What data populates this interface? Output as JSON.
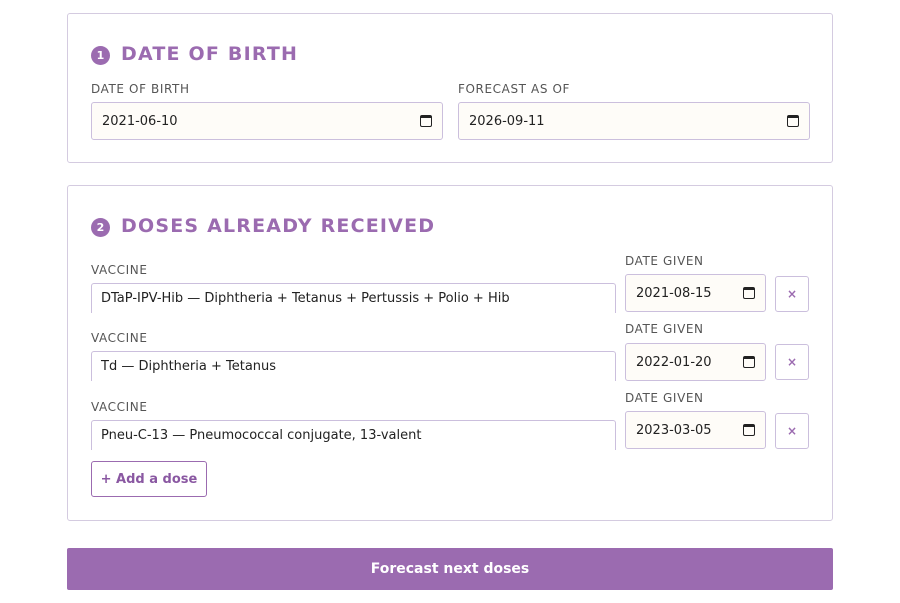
{
  "dob_section": {
    "step": "1",
    "title": "Date of birth",
    "dob_label": "DATE OF BIRTH",
    "dob_value": "2021-06-10",
    "forecast_label": "FORECAST AS OF",
    "forecast_value": "2026-09-11"
  },
  "doses_section": {
    "step": "2",
    "title": "Doses already received",
    "doses": [
      {
        "vaccine_label": "VACCINE",
        "vaccine": "DTaP-IPV-Hib — Diphtheria + Tetanus + Pertussis + Polio + Hib",
        "date_label": "DATE GIVEN",
        "date": "2021-08-15",
        "remove": "×"
      },
      {
        "vaccine_label": "VACCINE",
        "vaccine": "Td — Diphtheria + Tetanus",
        "date_label": "DATE GIVEN",
        "date": "2022-01-20",
        "remove": "×"
      },
      {
        "vaccine_label": "VACCINE",
        "vaccine": "Pneu-C-13 — Pneumococcal conjugate, 13-valent",
        "date_label": "DATE GIVEN",
        "date": "2023-03-05",
        "remove": "×"
      }
    ],
    "add_label": "+ Add a dose"
  },
  "submit_label": "Forecast next doses",
  "colors": {
    "accent": "#9b6bb0",
    "border": "#d4cbe0"
  },
  "icons": {
    "date_picker": "calendar-icon",
    "remove": "close-icon"
  }
}
